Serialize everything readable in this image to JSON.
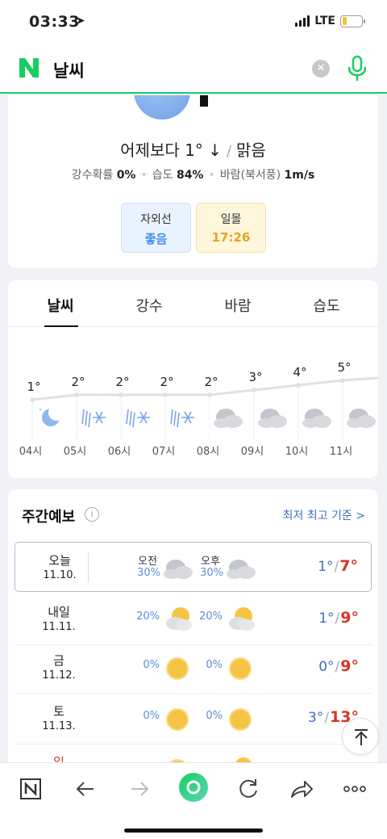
{
  "status": {
    "time": "03:33",
    "network": "LTE",
    "battery_level": 0.25
  },
  "search": {
    "query": "날씨"
  },
  "current": {
    "compare": "어제보다 1° ↓",
    "condition": "맑음",
    "rain_label": "강수확률",
    "rain_value": "0%",
    "humidity_label": "습도",
    "humidity_value": "84%",
    "wind_label": "바람(북서풍)",
    "wind_value": "1m/s",
    "uv_label": "자외선",
    "uv_value": "좋음",
    "sunset_label": "일몰",
    "sunset_value": "17:26"
  },
  "tabs": [
    "날씨",
    "강수",
    "바람",
    "습도"
  ],
  "hourly": {
    "times": [
      "04시",
      "05시",
      "06시",
      "07시",
      "08시",
      "09시",
      "10시",
      "11시"
    ],
    "temps": [
      "1°",
      "2°",
      "2°",
      "2°",
      "2°",
      "3°",
      "4°",
      "5°"
    ],
    "icons": [
      "moon-icon",
      "snow-rain-icon",
      "snow-rain-icon",
      "snow-rain-icon",
      "cloudy-icon",
      "cloudy-icon",
      "cloudy-icon",
      "cloudy-icon"
    ]
  },
  "weekly": {
    "title": "주간예보",
    "link": "최저 최고 기준 >",
    "am_label": "오전",
    "pm_label": "오후",
    "days": [
      {
        "name": "오늘",
        "date": "11.10.",
        "am_rain": "30%",
        "pm_rain": "30%",
        "am_icon": "cloudy-icon",
        "pm_icon": "cloudy-icon",
        "min": "1°",
        "max": "7°"
      },
      {
        "name": "내일",
        "date": "11.11.",
        "am_rain": "20%",
        "pm_rain": "20%",
        "am_icon": "partly-cloudy-icon",
        "pm_icon": "partly-cloudy-icon",
        "min": "1°",
        "max": "9°"
      },
      {
        "name": "금",
        "date": "11.12.",
        "am_rain": "0%",
        "pm_rain": "0%",
        "am_icon": "sun-icon",
        "pm_icon": "sun-icon",
        "min": "0°",
        "max": "9°"
      },
      {
        "name": "토",
        "date": "11.13.",
        "am_rain": "0%",
        "pm_rain": "0%",
        "am_icon": "sun-icon",
        "pm_icon": "sun-icon",
        "min": "3°",
        "max": "13°"
      },
      {
        "name": "일",
        "date": "",
        "am_rain": "",
        "pm_rain": "",
        "am_icon": "sun-icon",
        "pm_icon": "partly-cloudy-icon",
        "min": "",
        "max": ""
      }
    ]
  },
  "colors": {
    "naver_green": "#19ce60",
    "min_blue": "#3f6fc9",
    "max_red": "#d3352c"
  }
}
